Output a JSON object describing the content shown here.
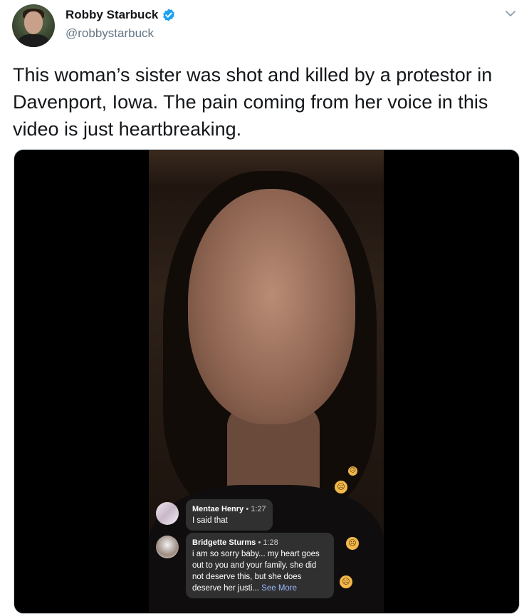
{
  "tweet": {
    "author_name": "Robby Starbuck",
    "author_handle": "@robbystarbuck",
    "text": "This woman’s sister was shot and killed by a protestor in Davenport, Iowa. The pain coming from her voice in this video is just heartbreaking."
  },
  "icons": {
    "verified": "verified-badge-icon",
    "more": "chevron-down-icon",
    "reaction": "sad-face-emoji-icon"
  },
  "colors": {
    "verified_blue": "#1da1f2",
    "handle_gray": "#657786",
    "text": "#14171a"
  },
  "video": {
    "comments": [
      {
        "name": "Mentae Henry",
        "time": "1:27",
        "text": "I said that"
      },
      {
        "name": "Bridgette Sturms",
        "time": "1:28",
        "text": "i am so sorry baby... my heart goes out to you and your family. she did not deserve this, but she does deserve her justi...",
        "more": "See More"
      }
    ],
    "time_separator": "•"
  }
}
